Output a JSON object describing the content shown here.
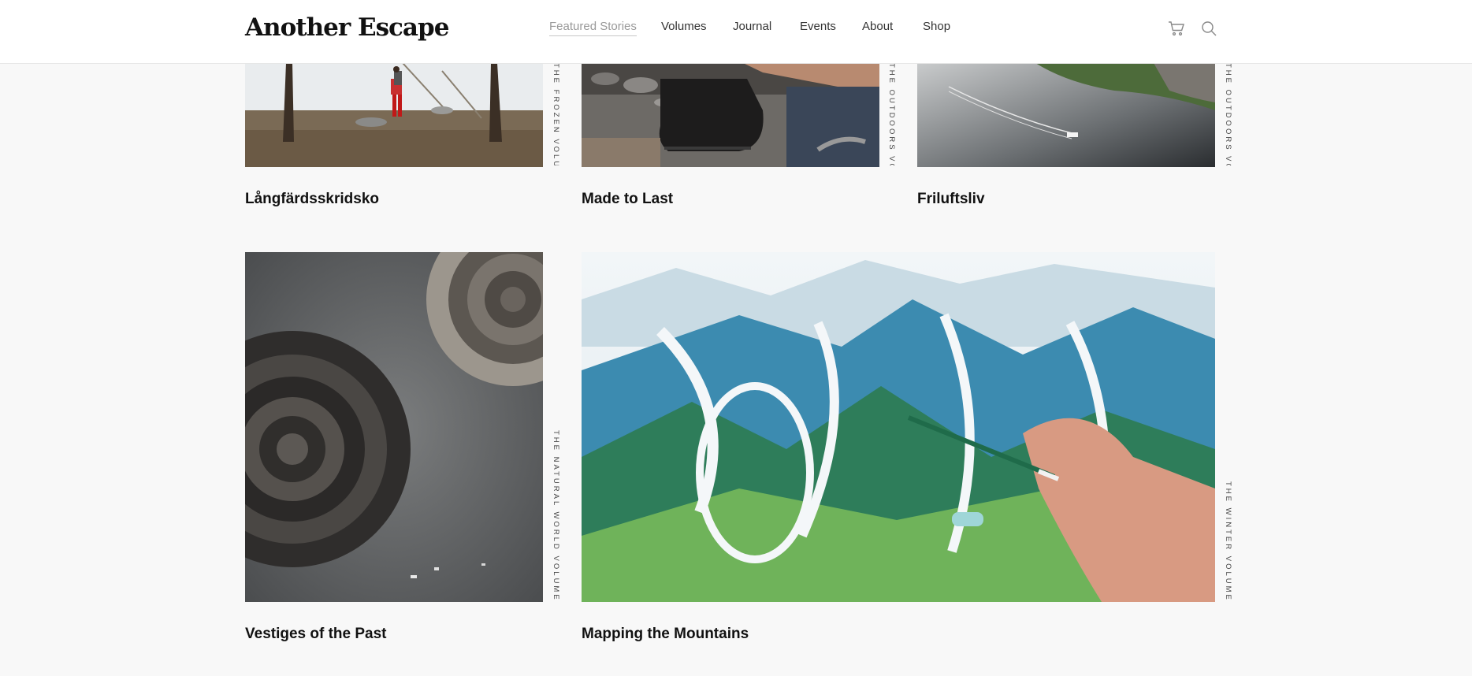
{
  "brand": {
    "name": "Another Escape"
  },
  "nav": {
    "items": [
      {
        "label": "Featured Stories",
        "active": true
      },
      {
        "label": "Volumes"
      },
      {
        "label": "Journal"
      },
      {
        "label": "Events"
      },
      {
        "label": "About"
      },
      {
        "label": "Shop"
      }
    ]
  },
  "header_icons": {
    "cart": "cart-icon",
    "search": "search-icon"
  },
  "stories": [
    {
      "title": "Långfärdsskridsko",
      "volume": "THE FROZEN VOLUME"
    },
    {
      "title": "Made to Last",
      "volume": "THE OUTDOORS VOLUME"
    },
    {
      "title": "Friluftsliv",
      "volume": "THE OUTDOORS VOLUME"
    },
    {
      "title": "Vestiges of the Past",
      "volume": "THE NATURAL WORLD VOLUME"
    },
    {
      "title": "Mapping the Mountains",
      "volume": "THE WINTER VOLUME"
    }
  ],
  "colors": {
    "background": "#f8f8f8",
    "header": "#ffffff",
    "active_nav": "#999999",
    "text": "#111111"
  }
}
